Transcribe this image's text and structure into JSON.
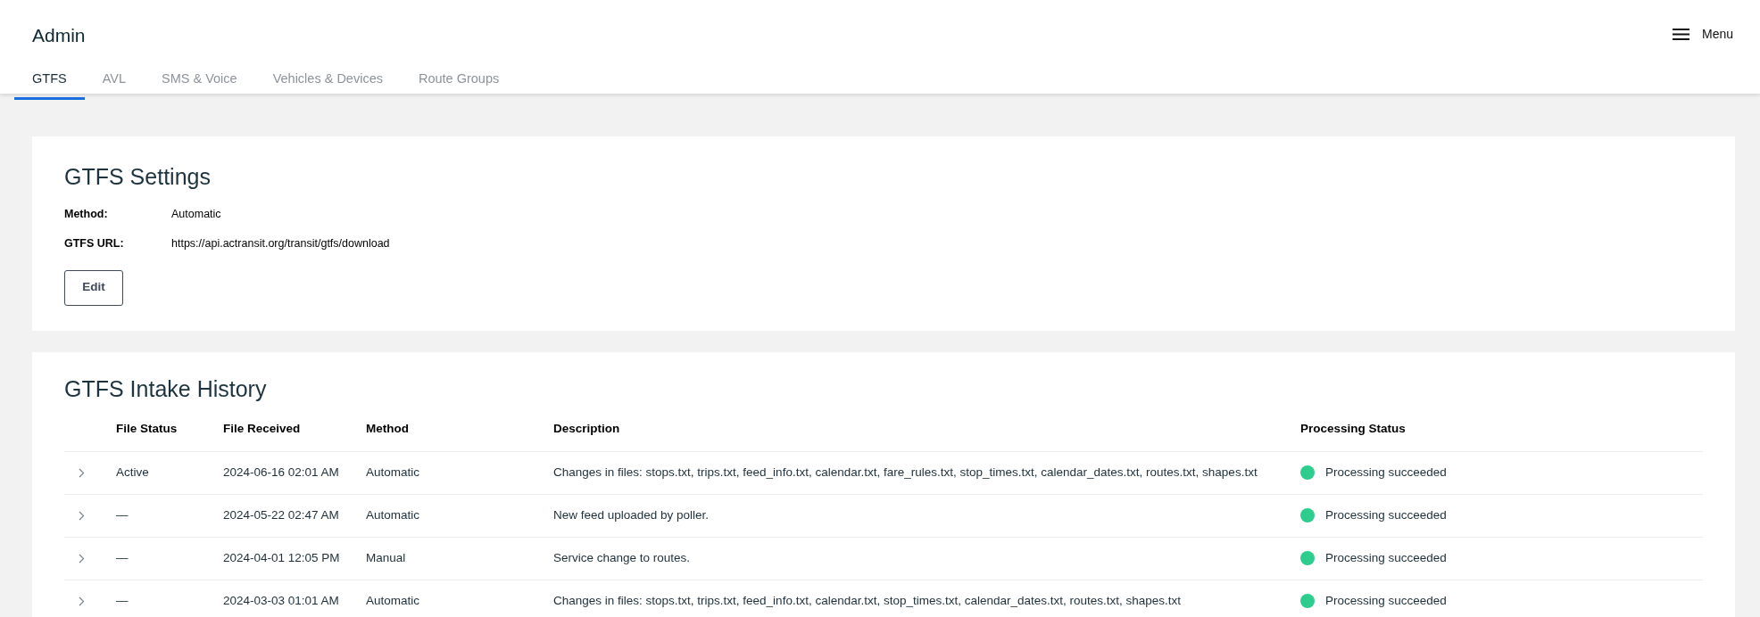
{
  "header": {
    "title": "Admin",
    "menu": {
      "label": "Menu"
    }
  },
  "tabs": [
    {
      "label": "GTFS",
      "selected": true
    },
    {
      "label": "AVL",
      "selected": false
    },
    {
      "label": "SMS & Voice",
      "selected": false
    },
    {
      "label": "Vehicles & Devices",
      "selected": false
    },
    {
      "label": "Route Groups",
      "selected": false
    }
  ],
  "settings": {
    "title": "GTFS Settings",
    "fields": [
      {
        "label": "Method:",
        "value": "Automatic"
      },
      {
        "label": "GTFS URL:",
        "value": "https://api.actransit.org/transit/gtfs/download"
      }
    ],
    "button": "Edit"
  },
  "history": {
    "title": "GTFS Intake History",
    "columns": [
      "File Status",
      "File Received",
      "Method",
      "Description",
      "Processing Status"
    ],
    "rows": [
      {
        "expanded": false,
        "file_status": "Active",
        "file_received": "2024-06-16 02:01 AM",
        "method": "Automatic",
        "description": "Changes in files: stops.txt, trips.txt, feed_info.txt, calendar.txt, fare_rules.txt, stop_times.txt, calendar_dates.txt, routes.txt, shapes.txt",
        "processing_status": "Processing succeeded",
        "color": "#2ecc8f"
      },
      {
        "expanded": false,
        "file_status": "—",
        "file_received": "2024-05-22 02:47 AM",
        "method": "Automatic",
        "description": "New feed uploaded by poller.",
        "processing_status": "Processing succeeded",
        "color": "#2ecc8f"
      },
      {
        "expanded": false,
        "file_status": "—",
        "file_received": "2024-04-01 12:05 PM",
        "method": "Manual",
        "description": "Service change to routes.",
        "processing_status": "Processing succeeded",
        "color": "#2ecc8f"
      },
      {
        "expanded": false,
        "file_status": "—",
        "file_received": "2024-03-03 01:01 AM",
        "method": "Automatic",
        "description": "Changes in files: stops.txt, trips.txt, feed_info.txt, calendar.txt, stop_times.txt, calendar_dates.txt, routes.txt, shapes.txt",
        "processing_status": "Processing succeeded",
        "color": "#2ecc8f"
      }
    ]
  }
}
